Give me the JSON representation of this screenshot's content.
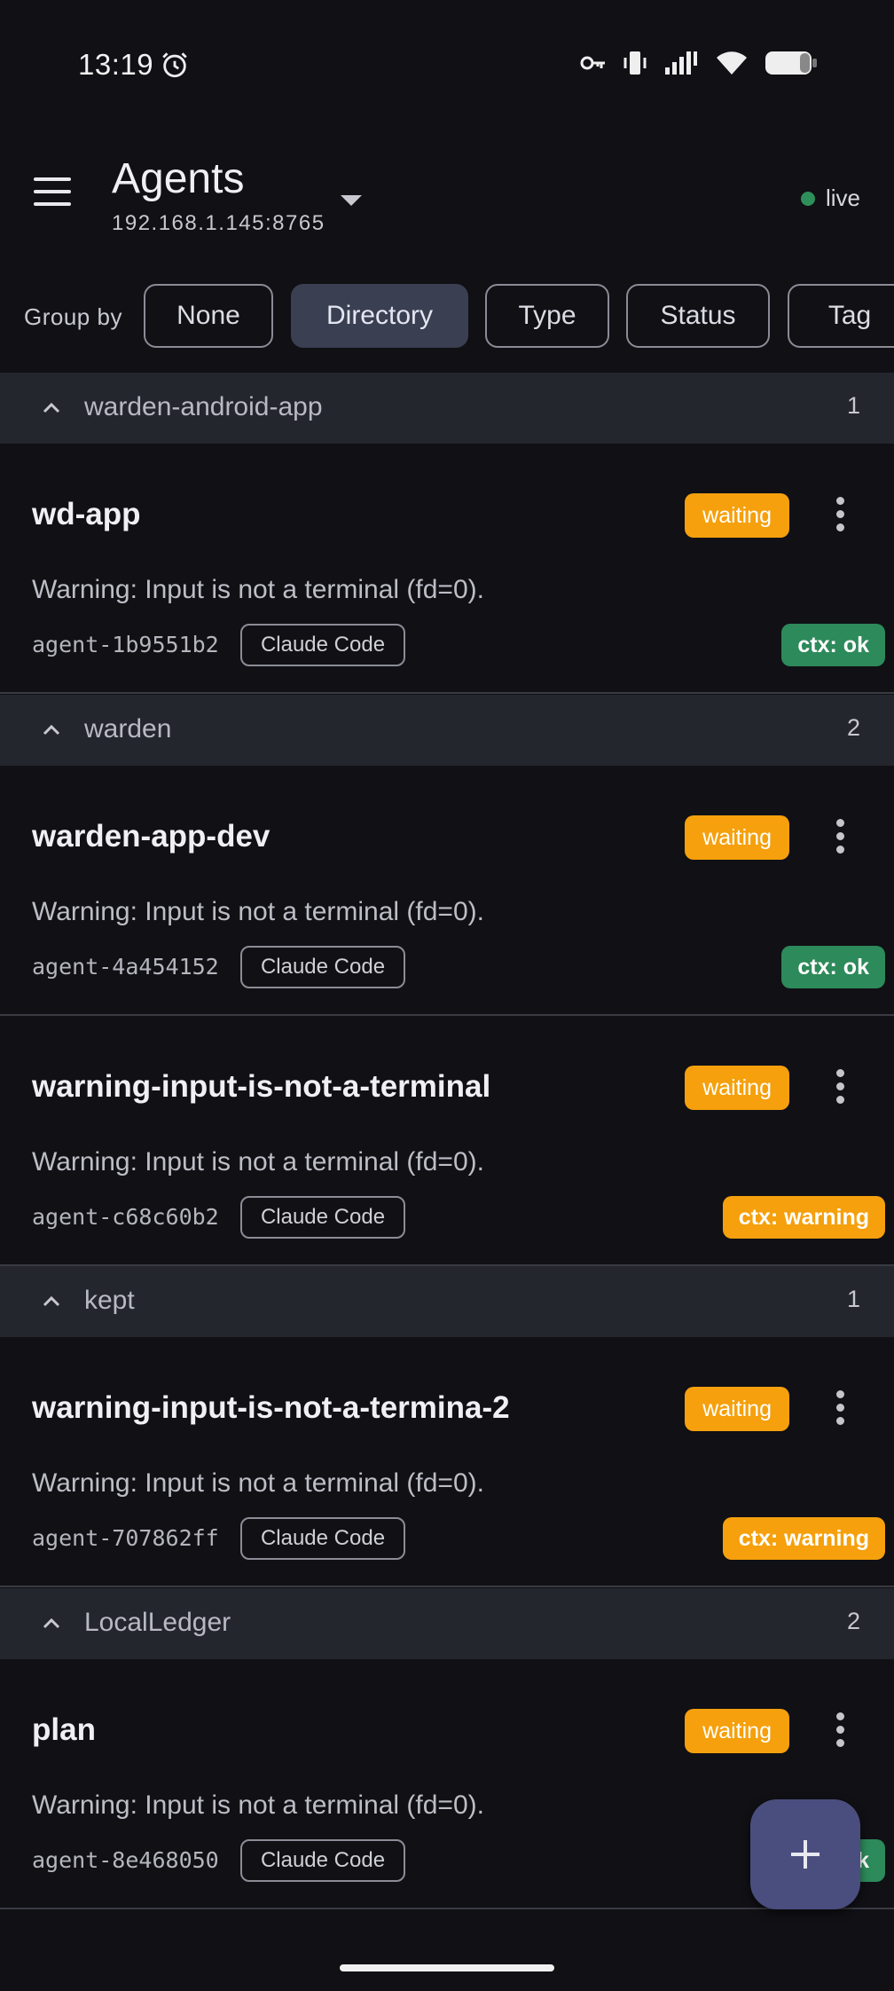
{
  "status_bar": {
    "time": "13:19",
    "icons": [
      "alarm-icon",
      "key-icon",
      "vibrate-icon",
      "signal-icon",
      "wifi-icon",
      "battery-icon"
    ]
  },
  "app_bar": {
    "title": "Agents",
    "subtitle": "192.168.1.145:8765",
    "live_label": "live",
    "live_color": "#2f8f5b"
  },
  "group_by": {
    "label": "Group by",
    "options": [
      "None",
      "Directory",
      "Type",
      "Status",
      "Tag"
    ],
    "selected": "Directory"
  },
  "groups": [
    {
      "name": "warden-android-app",
      "count": "1",
      "agents": [
        {
          "name": "wd-app",
          "status": "waiting",
          "message": "Warning: Input is not a terminal (fd=0).",
          "id": "agent-1b9551b2",
          "type": "Claude Code",
          "ctx": "ctx: ok"
        }
      ]
    },
    {
      "name": "warden",
      "count": "2",
      "agents": [
        {
          "name": "warden-app-dev",
          "status": "waiting",
          "message": "Warning: Input is not a terminal (fd=0).",
          "id": "agent-4a454152",
          "type": "Claude Code",
          "ctx": "ctx: ok"
        },
        {
          "name": "warning-input-is-not-a-terminal",
          "status": "waiting",
          "message": "Warning: Input is not a terminal (fd=0).",
          "id": "agent-c68c60b2",
          "type": "Claude Code",
          "ctx": "ctx: warning"
        }
      ]
    },
    {
      "name": "kept",
      "count": "1",
      "agents": [
        {
          "name": "warning-input-is-not-a-termina-2",
          "status": "waiting",
          "message": "Warning: Input is not a terminal (fd=0).",
          "id": "agent-707862ff",
          "type": "Claude Code",
          "ctx": "ctx: warning"
        }
      ]
    },
    {
      "name": "LocalLedger",
      "count": "2",
      "agents": [
        {
          "name": "plan",
          "status": "waiting",
          "message": "Warning: Input is not a terminal (fd=0).",
          "id": "agent-8e468050",
          "type": "Claude Code",
          "ctx": "ctx: ok"
        }
      ]
    }
  ],
  "colors": {
    "waiting": "#f5a00c",
    "ctx_ok": "#2d8a5a",
    "ctx_warning": "#f5a00c",
    "fab": "#4a4e7e"
  },
  "fab": {
    "icon": "plus-icon"
  }
}
